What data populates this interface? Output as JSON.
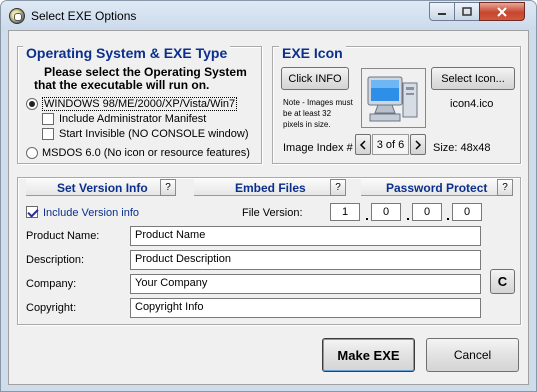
{
  "window": {
    "title": "Select EXE Options"
  },
  "os_group": {
    "title": "Operating System & EXE Type",
    "instruction_line1": "Please select the Operating System",
    "instruction_line2": "that the executable will run on.",
    "windows_option": "WINDOWS  98/ME/2000/XP/Vista/Win7",
    "admin_manifest": "Include Administrator Manifest",
    "start_invisible": "Start Invisible   (NO CONSOLE window)",
    "msdos_option": "MSDOS 6.0  (No icon or resource features)",
    "windows_selected": true,
    "admin_checked": false,
    "invisible_checked": false
  },
  "icon_group": {
    "title": "EXE Icon",
    "click_info_label": "Click INFO",
    "select_icon_label": "Select Icon...",
    "note": "Note - Images must be at least 32 pixels in size.",
    "icon_name": "icon4.ico",
    "image_index_label": "Image Index #",
    "image_index_value": "3 of 6",
    "size_label": "Size: 48x48"
  },
  "tabs": [
    {
      "label": "Set Version Info",
      "help": "?"
    },
    {
      "label": "Embed Files",
      "help": "?"
    },
    {
      "label": "Password Protect",
      "help": "?"
    }
  ],
  "version": {
    "include_label": "Include Version info",
    "include_checked": true,
    "file_version_label": "File Version:",
    "file_version": [
      "1",
      "0",
      "0",
      "0"
    ],
    "product_name_label": "Product Name:",
    "product_name": "Product Name",
    "description_label": "Description:",
    "description": "Product Description",
    "company_label": "Company:",
    "company": "Your Company",
    "copyright_label": "Copyright:",
    "copyright": "Copyright Info",
    "c_button": "C"
  },
  "footer": {
    "make_exe_label": "Make EXE",
    "cancel_label": "Cancel"
  },
  "colors": {
    "accent_blue": "#0a2f8c",
    "window_frame": "#cfdcec",
    "close_red": "#c6462f"
  }
}
